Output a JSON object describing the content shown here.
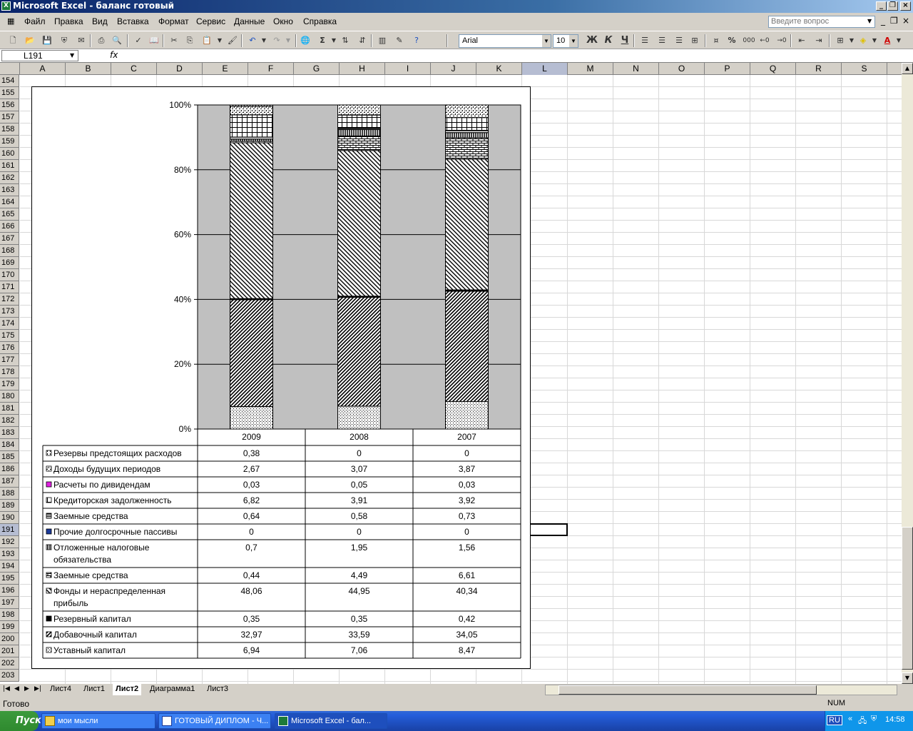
{
  "window": {
    "title": "Microsoft Excel - баланс готовый"
  },
  "menu": [
    "Файл",
    "Правка",
    "Вид",
    "Вставка",
    "Формат",
    "Сервис",
    "Данные",
    "Окно",
    "Справка"
  ],
  "ask_placeholder": "Введите вопрос",
  "font": {
    "name": "Arial",
    "size": "10"
  },
  "format_buttons": {
    "bold": "Ж",
    "italic": "К",
    "underline": "Ч",
    "percent": "%",
    "thousands": "000"
  },
  "namebox": "L191",
  "fx": "fx",
  "columns": [
    "A",
    "B",
    "C",
    "D",
    "E",
    "F",
    "G",
    "H",
    "I",
    "J",
    "K",
    "L",
    "M",
    "N",
    "O",
    "P",
    "Q",
    "R",
    "S"
  ],
  "rows": [
    "154",
    "155",
    "156",
    "157",
    "158",
    "159",
    "160",
    "161",
    "162",
    "163",
    "164",
    "165",
    "166",
    "167",
    "168",
    "169",
    "170",
    "171",
    "172",
    "173",
    "174",
    "175",
    "176",
    "177",
    "178",
    "179",
    "180",
    "181",
    "182",
    "183",
    "184",
    "185",
    "186",
    "187",
    "188",
    "189",
    "190",
    "191",
    "192",
    "193",
    "194",
    "195",
    "196",
    "197",
    "198",
    "199",
    "200",
    "201",
    "202",
    "203"
  ],
  "selected_row": "191",
  "selected_col": "L",
  "chart_data": {
    "type": "bar",
    "stacked": "percent",
    "categories": [
      "2009",
      "2008",
      "2007"
    ],
    "y_ticks": [
      "100%",
      "80%",
      "60%",
      "40%",
      "20%",
      "0%"
    ],
    "ylim": [
      0,
      100
    ],
    "series": [
      {
        "name": "Уставный капитал",
        "values": [
          "6,94",
          "7,06",
          "8,47"
        ],
        "num": [
          6.94,
          7.06,
          8.47
        ],
        "pattern": "p-dots"
      },
      {
        "name": "Добавочный капитал",
        "values": [
          "32,97",
          "33,59",
          "34,05"
        ],
        "num": [
          32.97,
          33.59,
          34.05
        ],
        "pattern": "p-fwd"
      },
      {
        "name": "Резервный капитал",
        "values": [
          "0,35",
          "0,35",
          "0,42"
        ],
        "num": [
          0.35,
          0.35,
          0.42
        ],
        "pattern": "p-solid"
      },
      {
        "name": "Фонды и нераспределенная прибыль",
        "values": [
          "48,06",
          "44,95",
          "40,34"
        ],
        "num": [
          48.06,
          44.95,
          40.34
        ],
        "pattern": "p-back"
      },
      {
        "name": "Заемные средства",
        "values": [
          "0,44",
          "4,49",
          "6,61"
        ],
        "num": [
          0.44,
          4.49,
          6.61
        ],
        "pattern": "p-brick"
      },
      {
        "name": "Отложенные налоговые обязательства",
        "values": [
          "0,7",
          "1,95",
          "1,56"
        ],
        "num": [
          0.7,
          1.95,
          1.56
        ],
        "pattern": "p-vert"
      },
      {
        "name": "Прочие долгосрочные пассивы",
        "values": [
          "0",
          "0",
          "0"
        ],
        "num": [
          0,
          0,
          0
        ],
        "pattern": "p-blue"
      },
      {
        "name": "Заемные средства",
        "values": [
          "0,64",
          "0,58",
          "0,73"
        ],
        "num": [
          0.64,
          0.58,
          0.73
        ],
        "pattern": "p-horiz"
      },
      {
        "name": "Кредиторская задолженность",
        "values": [
          "6,82",
          "3,91",
          "3,92"
        ],
        "num": [
          6.82,
          3.91,
          3.92
        ],
        "pattern": "p-grid"
      },
      {
        "name": "Расчеты по дивидендам",
        "values": [
          "0,03",
          "0,05",
          "0,03"
        ],
        "num": [
          0.03,
          0.05,
          0.03
        ],
        "pattern": "p-magenta"
      },
      {
        "name": "Доходы будущих периодов",
        "values": [
          "2,67",
          "3,07",
          "3,87"
        ],
        "num": [
          2.67,
          3.07,
          3.87
        ],
        "pattern": "p-confetti"
      },
      {
        "name": "Резервы предстоящих расходов",
        "values": [
          "0,38",
          "0",
          "0"
        ],
        "num": [
          0.38,
          0,
          0
        ],
        "pattern": "p-white"
      }
    ],
    "colors": {
      "plot_bg": "#c0c0c0"
    }
  },
  "sheet_tabs": [
    "Лист4",
    "Лист1",
    "Лист2",
    "Диаграмма1",
    "Лист3"
  ],
  "active_tab": "Лист2",
  "status": {
    "left": "Готово",
    "num": "NUM"
  },
  "taskbar": {
    "start": "Пуск",
    "tasks": [
      "мои мысли",
      "ГОТОВЫЙ ДИПЛОМ - Ч...",
      "Microsoft Excel - бал..."
    ],
    "lang": "RU",
    "clock": "14:58"
  }
}
